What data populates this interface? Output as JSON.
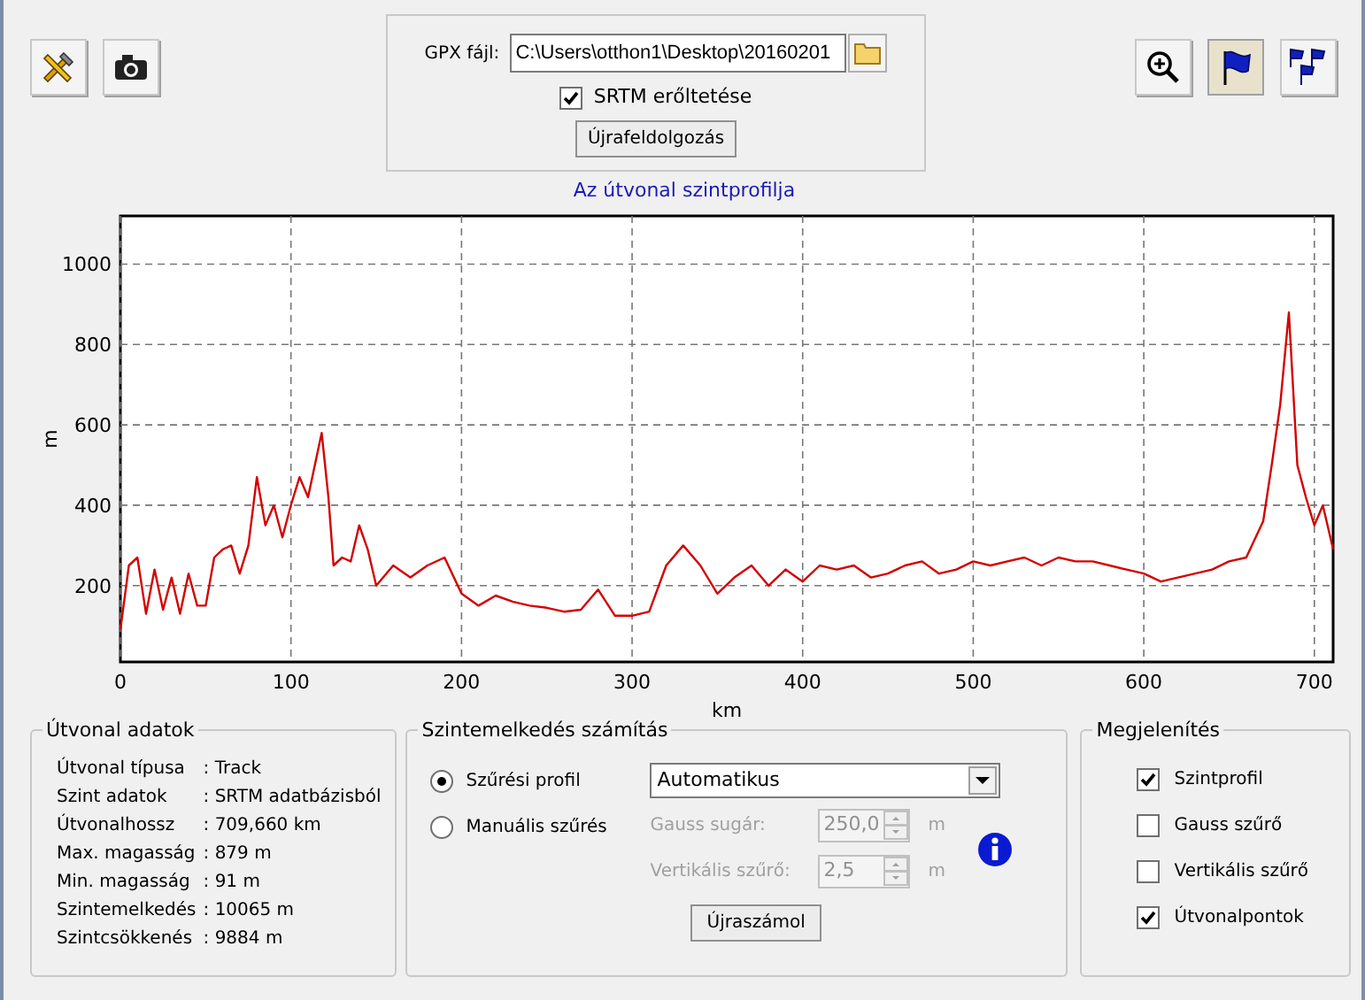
{
  "left_tools": [
    {
      "kind": "tools",
      "selected": false
    },
    {
      "kind": "camera",
      "selected": false
    }
  ],
  "gpx": {
    "label": "GPX fájl:",
    "value": "C:\\Users\\otthon1\\Desktop\\20160201",
    "srtm": {
      "label": "SRTM erőltetése",
      "checked": true
    },
    "button": "Újrafeldolgozás"
  },
  "right_tools": [
    {
      "kind": "zoom",
      "selected": false
    },
    {
      "kind": "flag",
      "selected": true
    },
    {
      "kind": "flags",
      "selected": false
    }
  ],
  "chart_title": "Az útvonal szintprofilja",
  "chart_data": {
    "type": "line",
    "xlabel": "km",
    "ylabel": "m",
    "xlim": [
      0,
      711
    ],
    "ylim": [
      10,
      1120
    ],
    "xticks": [
      0,
      100,
      200,
      300,
      400,
      500,
      600,
      700
    ],
    "yticks": [
      200,
      400,
      600,
      800,
      1000
    ],
    "x": [
      0,
      5,
      10,
      15,
      20,
      25,
      30,
      35,
      40,
      45,
      50,
      55,
      60,
      65,
      70,
      75,
      80,
      85,
      90,
      95,
      100,
      105,
      110,
      115,
      118,
      122,
      125,
      130,
      135,
      140,
      145,
      150,
      160,
      170,
      180,
      190,
      200,
      210,
      220,
      230,
      240,
      250,
      260,
      270,
      280,
      290,
      300,
      310,
      320,
      330,
      340,
      350,
      360,
      370,
      380,
      390,
      400,
      410,
      420,
      430,
      440,
      450,
      460,
      470,
      480,
      490,
      500,
      510,
      520,
      530,
      540,
      550,
      560,
      570,
      580,
      590,
      600,
      610,
      620,
      630,
      640,
      650,
      660,
      670,
      675,
      680,
      685,
      690,
      695,
      700,
      705,
      711
    ],
    "grid": true,
    "series": [
      {
        "color": "#d40000",
        "values": [
          90,
          250,
          270,
          130,
          240,
          140,
          220,
          130,
          230,
          150,
          150,
          270,
          290,
          300,
          230,
          300,
          470,
          350,
          400,
          320,
          400,
          470,
          420,
          520,
          580,
          420,
          250,
          270,
          260,
          350,
          290,
          200,
          250,
          220,
          250,
          270,
          180,
          150,
          175,
          160,
          150,
          145,
          135,
          140,
          190,
          125,
          125,
          135,
          250,
          300,
          250,
          180,
          220,
          250,
          200,
          240,
          210,
          250,
          240,
          250,
          220,
          230,
          250,
          260,
          230,
          240,
          260,
          250,
          260,
          270,
          250,
          270,
          260,
          260,
          250,
          240,
          230,
          210,
          220,
          230,
          240,
          260,
          270,
          360,
          500,
          650,
          880,
          500,
          420,
          350,
          400,
          290
        ]
      }
    ]
  },
  "route_info": {
    "title": "Útvonal adatok",
    "rows": [
      {
        "label": "Útvonal típusa",
        "value": ": Track"
      },
      {
        "label": "Szint adatok",
        "value": ": SRTM adatbázisból"
      },
      {
        "label": "Útvonalhossz",
        "value": ": 709,660 km"
      },
      {
        "label": "Max. magasság",
        "value": ": 879 m"
      },
      {
        "label": "Min. magasság",
        "value": ": 91 m"
      },
      {
        "label": "Szintemelkedés",
        "value": ": 10065 m"
      },
      {
        "label": "Szintcsökkenés",
        "value": ": 9884 m"
      }
    ]
  },
  "calculation": {
    "title": "Szintemelkedés számítás",
    "radios": [
      {
        "label": "Szűrési profil",
        "selected": true
      },
      {
        "label": "Manuális szűrés",
        "selected": false
      }
    ],
    "dropdown": "Automatikus",
    "fields": [
      {
        "label": "Gauss sugár:",
        "value": "250,0",
        "unit": "m",
        "disabled": true
      },
      {
        "label": "Vertikális szűrő:",
        "value": "2,5",
        "unit": "m",
        "disabled": true
      }
    ],
    "button": "Újraszámol"
  },
  "display": {
    "title": "Megjelenítés",
    "checkboxes": [
      {
        "label": "Szintprofil",
        "checked": true
      },
      {
        "label": "Gauss szűrő",
        "checked": false
      },
      {
        "label": "Vertikális szűrő",
        "checked": false
      },
      {
        "label": "Útvonalpontok",
        "checked": true
      }
    ]
  }
}
